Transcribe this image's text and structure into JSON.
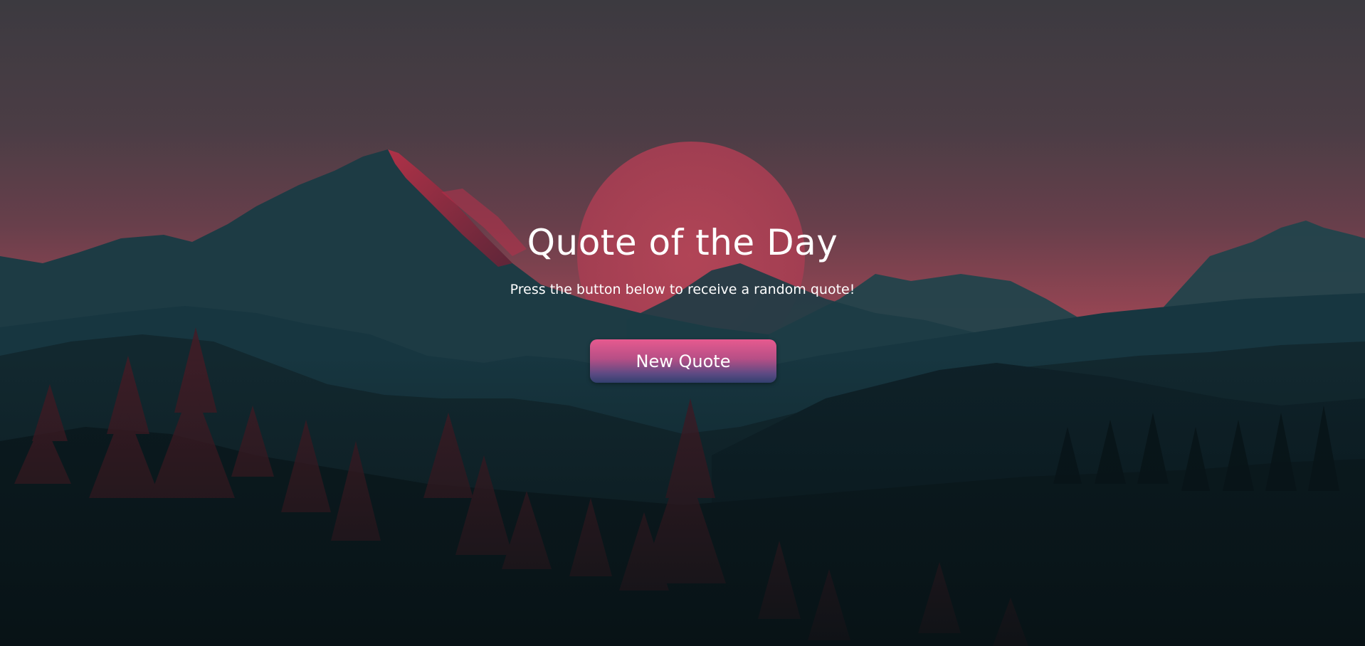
{
  "page": {
    "title": "Quote of the Day",
    "subtitle": "Press the button below to receive a random quote!"
  },
  "actions": {
    "new_quote_label": "New Quote"
  },
  "background": {
    "description_icon": "mountain-sunset-landscape",
    "colors": {
      "sky_top": "#3b3b40",
      "sky_glow": "#b24c59",
      "sun": "#b43f55",
      "mountain_teal": "#1f3f48",
      "forest_dark": "#0a161a",
      "tree_red": "#5a1e27"
    }
  },
  "button_colors": {
    "gradient_top": "#e75a8f",
    "gradient_bottom": "#33406f",
    "text": "#ffffff"
  }
}
